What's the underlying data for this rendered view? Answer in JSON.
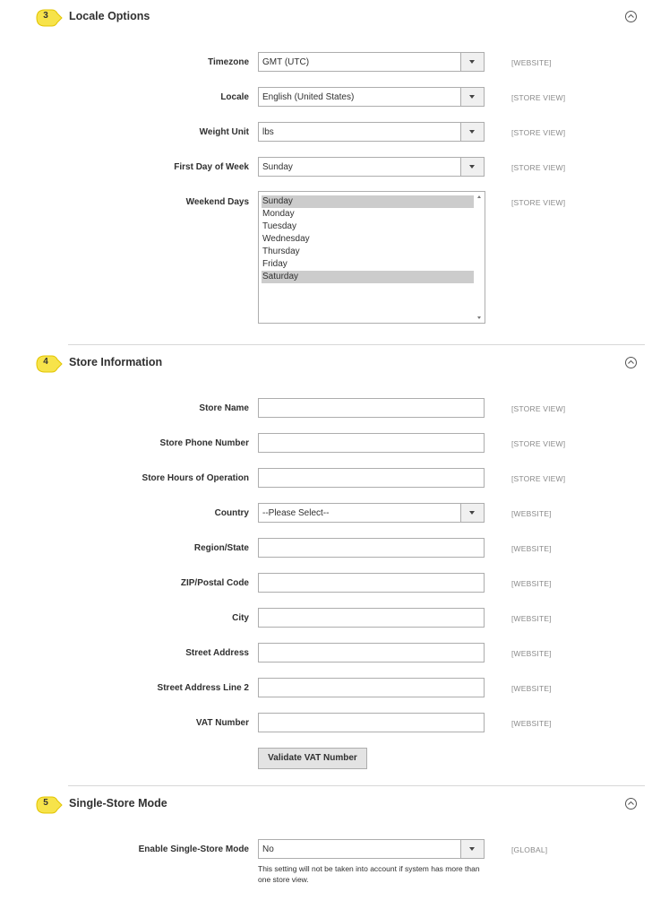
{
  "colors": {
    "badge": "#f7e34a",
    "badge_border": "#e2c400",
    "divider": "#d8d8d8",
    "select_highlight": "#cccccc"
  },
  "locale_options": {
    "badge": "3",
    "title": "Locale Options",
    "collapse_icon": "circle-chevron-up-icon",
    "fields": {
      "timezone": {
        "label": "Timezone",
        "value": "GMT (UTC)",
        "scope": "[WEBSITE]"
      },
      "locale": {
        "label": "Locale",
        "value": "English (United States)",
        "scope": "[STORE VIEW]"
      },
      "weight_unit": {
        "label": "Weight Unit",
        "value": "lbs",
        "scope": "[STORE VIEW]"
      },
      "first_day": {
        "label": "First Day of Week",
        "value": "Sunday",
        "scope": "[STORE VIEW]"
      },
      "weekend_days": {
        "label": "Weekend Days",
        "scope": "[STORE VIEW]",
        "options": [
          "Sunday",
          "Monday",
          "Tuesday",
          "Wednesday",
          "Thursday",
          "Friday",
          "Saturday"
        ],
        "selected": [
          "Sunday",
          "Saturday"
        ]
      }
    }
  },
  "store_information": {
    "badge": "4",
    "title": "Store Information",
    "fields": {
      "store_name": {
        "label": "Store Name",
        "value": "",
        "scope": "[STORE VIEW]"
      },
      "store_phone": {
        "label": "Store Phone Number",
        "value": "",
        "scope": "[STORE VIEW]"
      },
      "store_hours": {
        "label": "Store Hours of Operation",
        "value": "",
        "scope": "[STORE VIEW]"
      },
      "country": {
        "label": "Country",
        "value": "--Please Select--",
        "scope": "[WEBSITE]"
      },
      "region": {
        "label": "Region/State",
        "value": "",
        "scope": "[WEBSITE]"
      },
      "zip": {
        "label": "ZIP/Postal Code",
        "value": "",
        "scope": "[WEBSITE]"
      },
      "city": {
        "label": "City",
        "value": "",
        "scope": "[WEBSITE]"
      },
      "street": {
        "label": "Street Address",
        "value": "",
        "scope": "[WEBSITE]"
      },
      "street2": {
        "label": "Street Address Line 2",
        "value": "",
        "scope": "[WEBSITE]"
      },
      "vat": {
        "label": "VAT Number",
        "value": "",
        "scope": "[WEBSITE]"
      }
    },
    "validate_button": "Validate VAT Number"
  },
  "single_store_mode": {
    "badge": "5",
    "title": "Single-Store Mode",
    "fields": {
      "enable": {
        "label": "Enable Single-Store Mode",
        "value": "No",
        "scope": "[GLOBAL]",
        "note": "This setting will not be taken into account if system has more than one store view."
      }
    }
  }
}
